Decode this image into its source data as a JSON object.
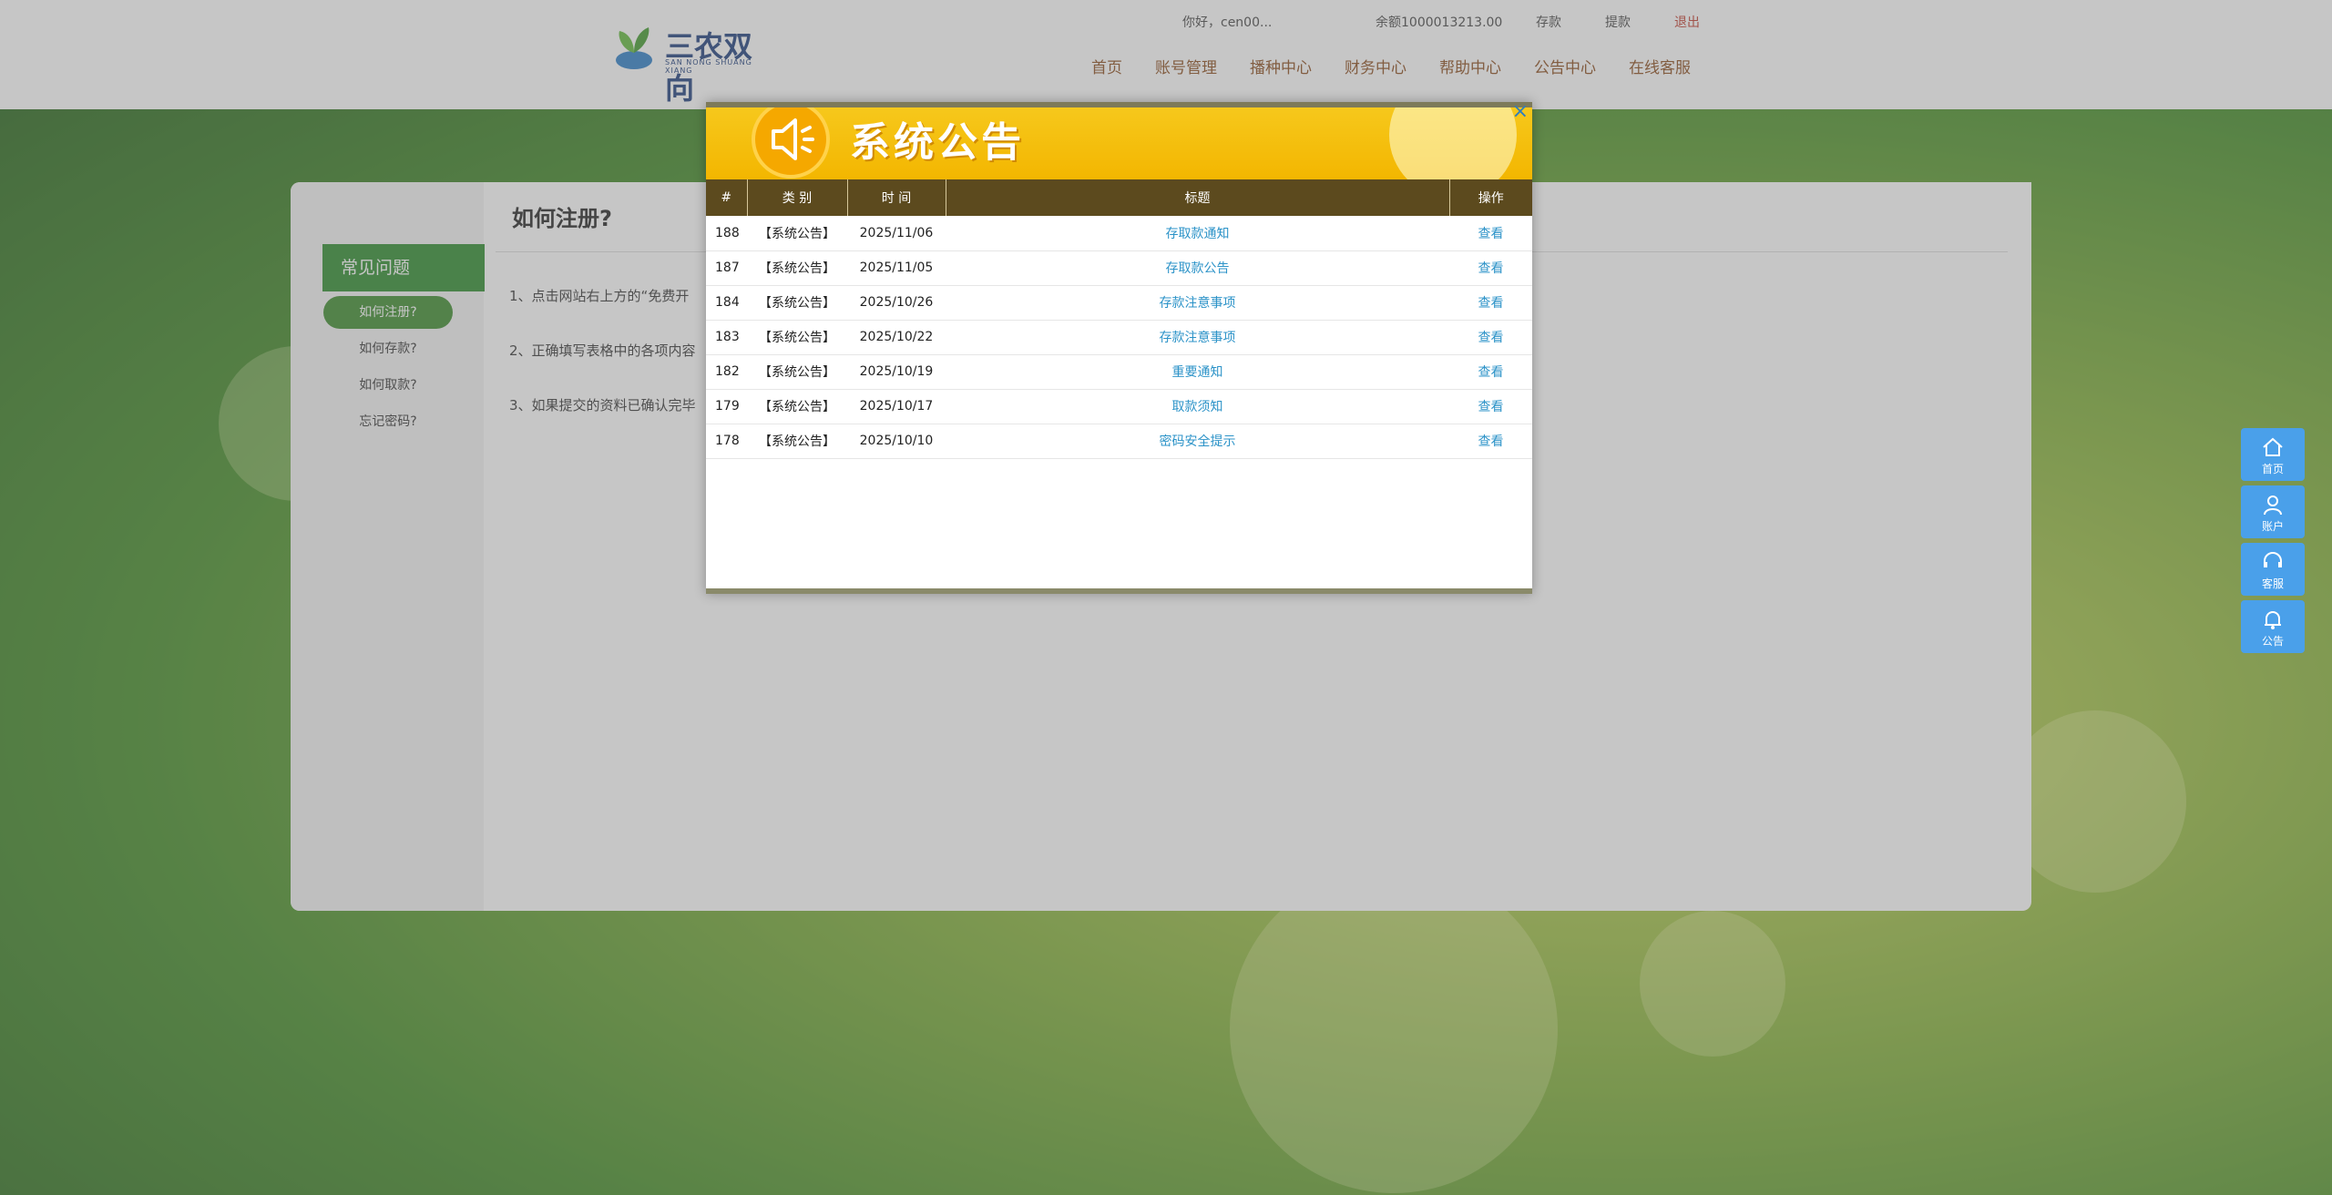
{
  "topbar": {
    "user_label": "你好，cen00...",
    "balance_label": "余额1000013213.00",
    "deposit_label": "存款",
    "withdraw_label": "提款",
    "logout_label": "退出"
  },
  "logo": {
    "title": "三农双向",
    "subtitle": "SAN NONG SHUANG XIANG"
  },
  "nav": [
    "首页",
    "账号管理",
    "播种中心",
    "财务中心",
    "帮助中心",
    "公告中心",
    "在线客服"
  ],
  "help": {
    "sidebar_title": "常见问题",
    "items": [
      "如何注册?",
      "如何存款?",
      "如何取款?",
      "忘记密码?"
    ],
    "page_title": "如何注册?",
    "paragraphs": [
      "1、点击网站右上方的“免费开",
      "2、正确填写表格中的各项内容",
      "3、如果提交的资料已确认完毕"
    ]
  },
  "float": [
    "首页",
    "账户",
    "客服",
    "公告"
  ],
  "modal": {
    "title": "系统公告",
    "close": "×",
    "columns": [
      "#",
      "类 别",
      "时 间",
      "标题",
      "操作"
    ],
    "rows": [
      {
        "id": "188",
        "type": "【系统公告】",
        "date": "2025/11/06",
        "title": "存取款通知",
        "op": "查看"
      },
      {
        "id": "187",
        "type": "【系统公告】",
        "date": "2025/11/05",
        "title": "存取款公告",
        "op": "查看"
      },
      {
        "id": "184",
        "type": "【系统公告】",
        "date": "2025/10/26",
        "title": "存款注意事项",
        "op": "查看"
      },
      {
        "id": "183",
        "type": "【系统公告】",
        "date": "2025/10/22",
        "title": "存款注意事项",
        "op": "查看"
      },
      {
        "id": "182",
        "type": "【系统公告】",
        "date": "2025/10/19",
        "title": "重要通知",
        "op": "查看"
      },
      {
        "id": "179",
        "type": "【系统公告】",
        "date": "2025/10/17",
        "title": "取款须知",
        "op": "查看"
      },
      {
        "id": "178",
        "type": "【系统公告】",
        "date": "2025/10/10",
        "title": "密码安全提示",
        "op": "查看"
      }
    ]
  }
}
